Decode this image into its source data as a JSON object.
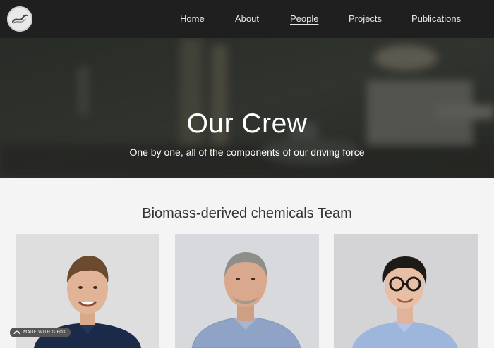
{
  "navbar": {
    "logo_icon": "lab-logo-icon",
    "links": [
      {
        "label": "Home",
        "active": false
      },
      {
        "label": "About",
        "active": false
      },
      {
        "label": "People",
        "active": true
      },
      {
        "label": "Projects",
        "active": false
      },
      {
        "label": "Publications",
        "active": false
      }
    ]
  },
  "hero": {
    "title": "Our Crew",
    "subtitle": "One by one, all of the components of our driving force"
  },
  "team": {
    "heading": "Biomass-derived chemicals Team",
    "members": [
      {
        "photo_icon": "member-photo-icon"
      },
      {
        "photo_icon": "member-photo-icon"
      },
      {
        "photo_icon": "member-photo-icon"
      }
    ]
  },
  "badge": {
    "text": "MADE WITH GIFOX",
    "icon": "gifox-icon"
  },
  "colors": {
    "navbar": "#1f1f1f",
    "hero_overlay": "#3a3d36",
    "page_background": "#f4f4f4",
    "heading_text": "#333333"
  }
}
